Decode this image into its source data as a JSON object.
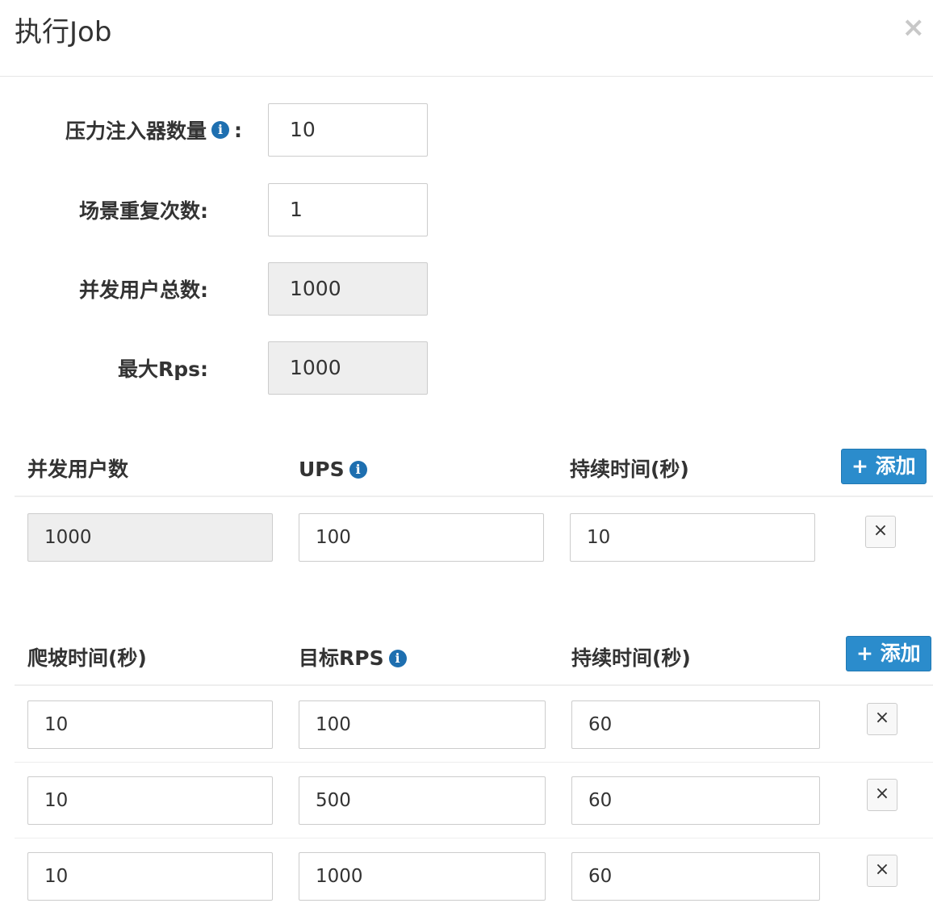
{
  "header": {
    "title": "执行Job",
    "close_label": "×"
  },
  "settings": {
    "injector_count": {
      "label": "压力注入器数量",
      "colon": ":",
      "value": "10"
    },
    "scenario_repeat": {
      "label": "场景重复次数:",
      "value": "1"
    },
    "total_concurrent_users": {
      "label": "并发用户总数:",
      "value": "1000"
    },
    "max_rps": {
      "label": "最大Rps:",
      "value": "1000"
    }
  },
  "ups_table": {
    "headers": [
      "并发用户数",
      "UPS",
      "持续时间(秒)"
    ],
    "add_label": "+ 添加",
    "rows": [
      {
        "users": "1000",
        "ups": "100",
        "duration": "10"
      }
    ],
    "delete_label": "×"
  },
  "rps_table": {
    "headers": [
      "爬坡时间(秒)",
      "目标RPS",
      "持续时间(秒)"
    ],
    "add_label": "+ 添加",
    "rows": [
      {
        "ramp": "10",
        "target_rps": "100",
        "duration": "60"
      },
      {
        "ramp": "10",
        "target_rps": "500",
        "duration": "60"
      },
      {
        "ramp": "10",
        "target_rps": "1000",
        "duration": "60"
      }
    ],
    "delete_label": "×"
  },
  "icons": {
    "info": "info-icon",
    "close": "close-icon"
  },
  "colors": {
    "primary_button": "#2b8ccc",
    "info_icon": "#1e6fb0",
    "readonly_bg": "#eeeeee"
  }
}
